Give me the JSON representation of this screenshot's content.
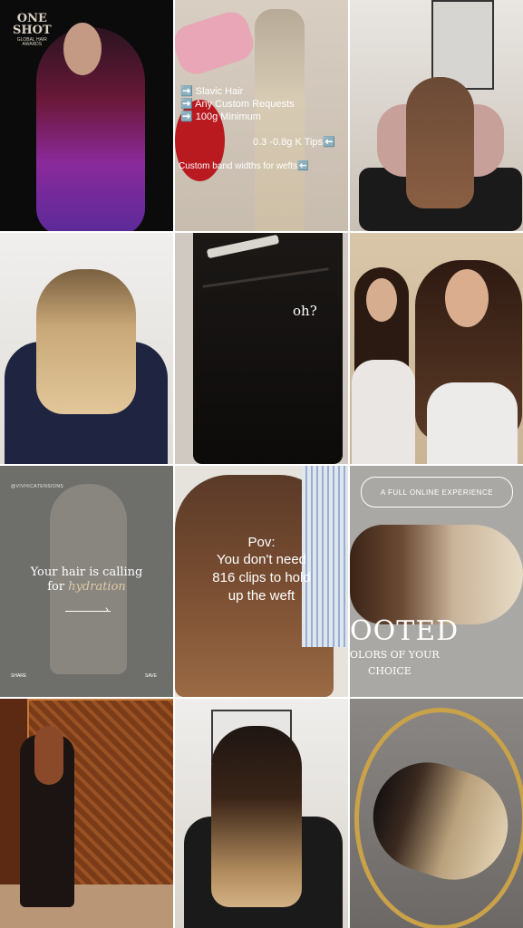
{
  "tiles": {
    "t1": {
      "logo_line1": "ONE",
      "logo_line2": "SHOT",
      "logo_line3": "GLOBAL HAIR",
      "logo_line4": "AWARDS"
    },
    "t2": {
      "line1": "➡️ Slavic Hair",
      "line2": "➡️ Any Custom Requests",
      "line3": "➡️ 100g Minimum",
      "line4": "0.3 -0.8g K Tips⬅️",
      "line5": "Custom band widths for wefts⬅️"
    },
    "t5": {
      "caption": "oh?"
    },
    "t7": {
      "handle": "@VIVHICATENSIONS",
      "line1": "Your hair is calling",
      "line2_prefix": "for ",
      "line2_highlight": "hydration",
      "share": "SHARE",
      "save": "SAVE"
    },
    "t8": {
      "line1": "Pov:",
      "line2": "You don't need",
      "line3": "816 clips to hold",
      "line4": "up the weft"
    },
    "t9": {
      "pill": "A FULL ONLINE EXPERIENCE",
      "big": "OOTED",
      "line2": "OLORS OF YOUR",
      "line3": "CHOICE"
    }
  },
  "colors": {
    "purple": "#7a2aa8",
    "magenta": "#b0265a",
    "navy": "#1f2440",
    "gold": "#c9a24a",
    "mocha": "#4a2e1e",
    "platinum": "#e8dcc6"
  }
}
